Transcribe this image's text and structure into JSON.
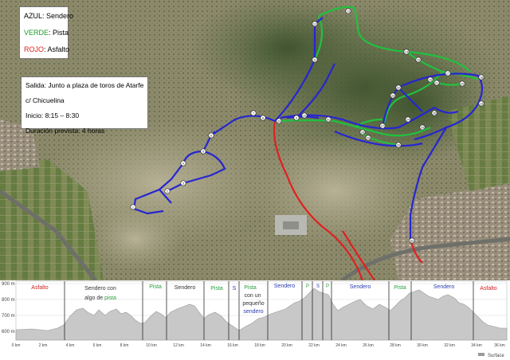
{
  "legend": {
    "blue": {
      "word": "AZUL",
      "rest": ": Sendero",
      "color": "#2323c8"
    },
    "green": {
      "word": "VERDE",
      "rest": ": Pista",
      "color": "#22a032"
    },
    "red": {
      "word": "ROJO",
      "rest": ": Asfalto",
      "color": "#e02020"
    }
  },
  "info": {
    "start_line1": "Salida: Junto a plaza de toros de Atarfe",
    "start_line2": "c/ Chicuelina",
    "start_time": "Inicio: 8:15 – 8:30",
    "duration": "Duración prevista: 4 horas"
  },
  "profile": {
    "surface_label": "Surface",
    "y_ticks": [
      "900 m",
      "800 m",
      "700 m",
      "600 m"
    ],
    "x_ticks": [
      "0 km",
      "2 km",
      "4 km",
      "6 km",
      "8 km",
      "10 km",
      "12 km",
      "14 km",
      "16 km",
      "18 km",
      "20 km",
      "22 km",
      "24 km",
      "26 km",
      "28 km",
      "30 km",
      "32 km",
      "34 km"
    ],
    "end_tick": "36 km",
    "segments": {
      "asfalto1": "Asfalto",
      "sendero1_a": "Sendero con",
      "sendero1_b1": "algo de ",
      "sendero1_b2": "pista",
      "pista1": "Pista",
      "sendero2": "Sendero",
      "pista2": "Pista",
      "s1": "S",
      "pista3_a": "Pista",
      "pista3_b": "con un",
      "pista3_c": "pequeño",
      "pista3_d": "sendero",
      "sendero3": "Sendero",
      "p1": "P",
      "s2": "S",
      "p2": "P",
      "sendero4": "Sendero",
      "pista4": "Pista",
      "sendero5": "Sendero",
      "asfalto2": "Asfalto"
    },
    "colors": {
      "red": "#d02020",
      "green": "#28a03c",
      "blue": "#2a3cb4",
      "text": "#333333"
    }
  },
  "waypoints": [
    "1",
    "2",
    "3",
    "4",
    "5",
    "6",
    "7",
    "8",
    "9",
    "10",
    "11",
    "12",
    "13",
    "14",
    "15",
    "16",
    "17",
    "18",
    "19",
    "20",
    "21",
    "22",
    "23",
    "24",
    "25",
    "26",
    "27",
    "28",
    "29",
    "30",
    "31",
    "32",
    "33"
  ]
}
